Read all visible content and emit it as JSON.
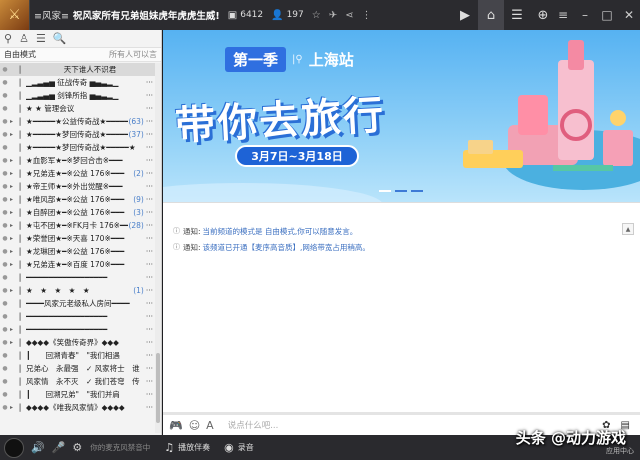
{
  "titlebar": {
    "room_tag": "≡风家≡",
    "room_name": "祝风家所有兄弟姐妹虎年虎虎生威!",
    "online_count": "6412",
    "user_count": "197"
  },
  "left": {
    "mode_label": "自由模式",
    "permission": "所有人可以言",
    "channels": [
      {
        "label": "天下谁人不识君",
        "count": "",
        "sel": true,
        "exp": ""
      },
      {
        "label": "▁▂▃▄▅ 征战传奇 ▅▄▃▂▁",
        "count": "",
        "exp": ""
      },
      {
        "label": "▁▂▃▄▅ 剑锋所指 ▅▄▃▂▁",
        "count": "",
        "exp": ""
      },
      {
        "label": "★ ★ 管理会议",
        "count": "",
        "exp": ""
      },
      {
        "label": "★━━━━━★公益传奇战★━━━━━★",
        "count": "(63)",
        "exp": "+"
      },
      {
        "label": "★━━━━━★梦回传奇战★━━━━━★",
        "count": "(37)",
        "exp": "+"
      },
      {
        "label": "★━━━━━★梦回传奇战★━━━━━★",
        "count": "",
        "exp": ""
      },
      {
        "label": "★血影军★━※梦回合击※━━━",
        "count": "",
        "exp": "+"
      },
      {
        "label": "★兄弟连★━※公益 176※━━━",
        "count": "(2)",
        "exp": "+"
      },
      {
        "label": "★帝王师★━※外出觉醒※━━━",
        "count": "",
        "exp": "+"
      },
      {
        "label": "★唯风部★━※公益 176※━━━",
        "count": "(9)",
        "exp": "+"
      },
      {
        "label": "★自醉团★━※公益 176※━━━",
        "count": "(3)",
        "exp": "+"
      },
      {
        "label": "★屯不团★━※FK月卡 176※━━",
        "count": "(28)",
        "exp": "+"
      },
      {
        "label": "★荣誉团★━※天喜 170※━━━",
        "count": "",
        "exp": "+"
      },
      {
        "label": "★龙琳团★━※公益 176※━━━",
        "count": "",
        "exp": "+"
      },
      {
        "label": "★兄弟连★━※百度 170※━━━",
        "count": "",
        "exp": "+"
      },
      {
        "label": "━━━━━━━━━━━━━━━━━━",
        "count": "",
        "exp": ""
      },
      {
        "label": "★　★　★　★　★",
        "count": "(1)",
        "exp": "+"
      },
      {
        "label": "━━━━风家元老级私人房间━━━━",
        "count": "",
        "exp": ""
      },
      {
        "label": "━━━━━━━━━━━━━━━━━━",
        "count": "",
        "exp": ""
      },
      {
        "label": "━━━━━━━━━━━━━━━━━━",
        "count": "",
        "exp": "+"
      },
      {
        "label": "◆◆◆◆《笑傲传奇界》◆◆◆",
        "count": "",
        "exp": "+"
      },
      {
        "label": "┃　　回溯青春\"　\"我们相遇",
        "count": "",
        "exp": ""
      },
      {
        "label": "兄弟心　永最强　✓ 风家将士　谁",
        "count": "",
        "exp": ""
      },
      {
        "label": "风家情　永不灭　✓ 我们苍穹　传",
        "count": "",
        "exp": ""
      },
      {
        "label": "┃　　回溯兄弟\"　\"我们并肩",
        "count": "",
        "exp": ""
      },
      {
        "label": "◆◆◆◆《唯我风家情》◆◆◆◆",
        "count": "",
        "exp": "+"
      }
    ]
  },
  "banner": {
    "season": "第一季",
    "station": "上海站",
    "slogan": "带你去旅行",
    "dates": "3月7日~3月18日"
  },
  "messages": [
    {
      "label": "通知:",
      "text": "当前频道的模式是 自由模式,你可以随意发言。"
    },
    {
      "label": "通知:",
      "text": "该频道已开通【麦序高音质】,网络带宽占用稍高。"
    }
  ],
  "input": {
    "placeholder": "说点什么吧..."
  },
  "bottom": {
    "mic_hint": "你的麦克风禁音中",
    "play_music": "播放伴奏",
    "record": "录音",
    "watermark": "头条 @动力游戏",
    "app_center": "应用中心"
  }
}
